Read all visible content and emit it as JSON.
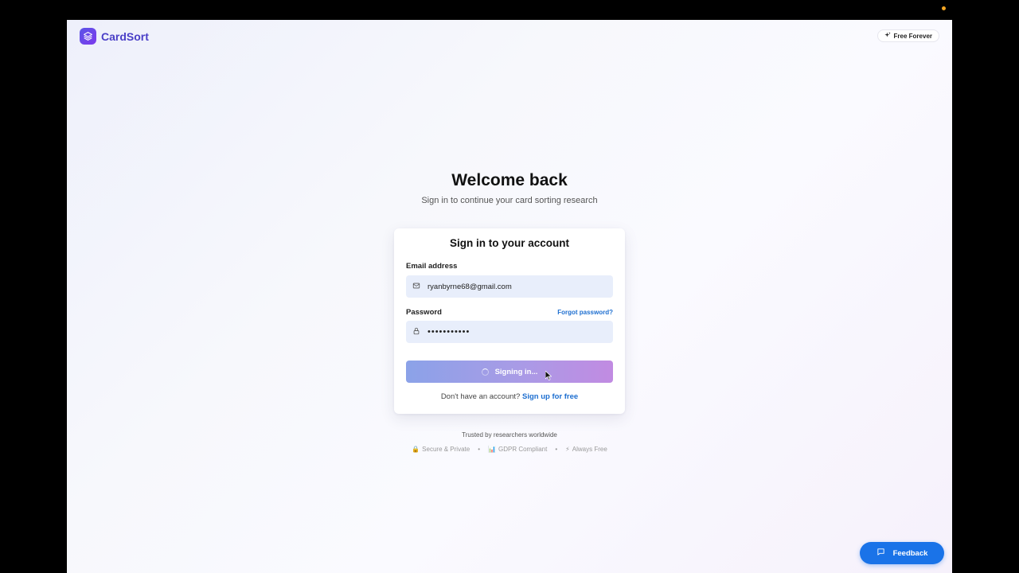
{
  "brand": {
    "name": "CardSort",
    "logo_icon": "layers-icon"
  },
  "header": {
    "badge_label": "Free Forever",
    "badge_icon": "sparkle-icon"
  },
  "hero": {
    "title": "Welcome back",
    "subtitle": "Sign in to continue your card sorting research"
  },
  "form": {
    "title": "Sign in to your account",
    "email_label": "Email address",
    "email_value": "ryanbyrne68@gmail.com",
    "email_icon": "mail-icon",
    "password_label": "Password",
    "forgot_label": "Forgot password?",
    "password_value": "•••••••••••",
    "password_icon": "lock-icon",
    "submit_label": "Signing in...",
    "submit_state": "loading",
    "signup_prompt": "Don't have an account?",
    "signup_link": "Sign up for free"
  },
  "trust": {
    "heading": "Trusted by researchers worldwide",
    "items": [
      {
        "icon": "🔒",
        "label": "Secure & Private"
      },
      {
        "icon": "📊",
        "label": "GDPR Compliant"
      },
      {
        "icon": "⚡",
        "label": "Always Free"
      }
    ],
    "separator": "•"
  },
  "feedback": {
    "label": "Feedback",
    "icon": "chat-icon"
  },
  "colors": {
    "brand": "#4a3fc7",
    "link": "#1e6fd0",
    "feedback_button": "#1a73e8",
    "input_bg": "#e8eefb"
  }
}
